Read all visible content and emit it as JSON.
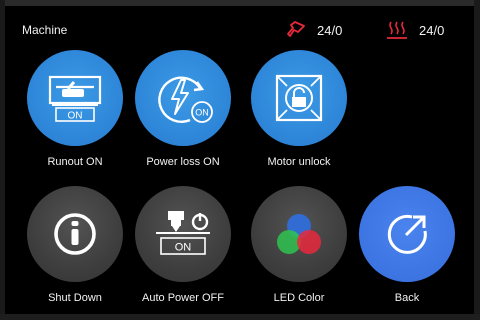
{
  "header": {
    "title": "Machine",
    "nozzle_temp": "24/0",
    "bed_temp": "24/0"
  },
  "colors": {
    "accent_blue": "#2e86d8",
    "back_blue": "#3c74e2",
    "tile_gray": "#3e3e3e",
    "temp_icon_red": "#e8293c"
  },
  "tiles": [
    {
      "label": "Runout ON",
      "icon": "filament-runout-icon",
      "badge": "ON"
    },
    {
      "label": "Power loss ON",
      "icon": "power-loss-recovery-icon",
      "badge": "ON"
    },
    {
      "label": "Motor unlock",
      "icon": "motor-unlock-icon"
    },
    {
      "label": "Shut Down",
      "icon": "power-icon"
    },
    {
      "label": "Auto Power OFF",
      "icon": "auto-power-off-icon",
      "badge": "ON"
    },
    {
      "label": "LED Color",
      "icon": "led-color-icon"
    },
    {
      "label": "Back",
      "icon": "back-arrow-icon"
    }
  ]
}
